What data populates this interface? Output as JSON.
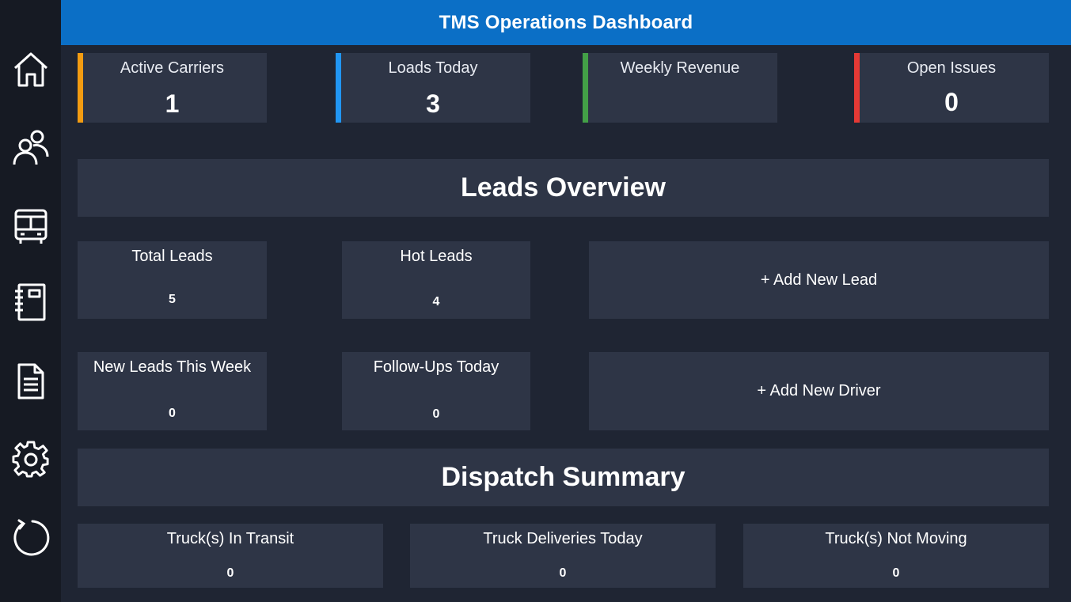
{
  "header": {
    "title": "TMS Operations Dashboard"
  },
  "sidebar": {
    "items": [
      {
        "icon": "home-icon"
      },
      {
        "icon": "users-icon"
      },
      {
        "icon": "bus-icon"
      },
      {
        "icon": "notebook-icon"
      },
      {
        "icon": "document-icon"
      },
      {
        "icon": "gear-icon"
      },
      {
        "icon": "refresh-icon"
      }
    ]
  },
  "kpis": [
    {
      "label": "Active Carriers",
      "value": "1",
      "color": "#f39c12"
    },
    {
      "label": "Loads Today",
      "value": "3",
      "color": "#2196f3"
    },
    {
      "label": "Weekly Revenue",
      "value": "",
      "color": "#43a047"
    },
    {
      "label": "Open Issues",
      "value": "0",
      "color": "#e53935"
    }
  ],
  "leads": {
    "title": "Leads Overview",
    "total": {
      "label": "Total Leads",
      "value": "5"
    },
    "hot": {
      "label": "Hot Leads",
      "value": "4"
    },
    "new_week": {
      "label": "New Leads This Week",
      "value": "0"
    },
    "followups": {
      "label": "Follow-Ups Today",
      "value": "0"
    },
    "add_lead_label": "+ Add New Lead",
    "add_driver_label": "+ Add New Driver"
  },
  "dispatch": {
    "title": "Dispatch Summary",
    "in_transit": {
      "label": "Truck(s) In Transit",
      "value": "0"
    },
    "deliveries": {
      "label": "Truck Deliveries Today",
      "value": "0"
    },
    "not_moving": {
      "label": "Truck(s) Not Moving",
      "value": "0"
    }
  }
}
